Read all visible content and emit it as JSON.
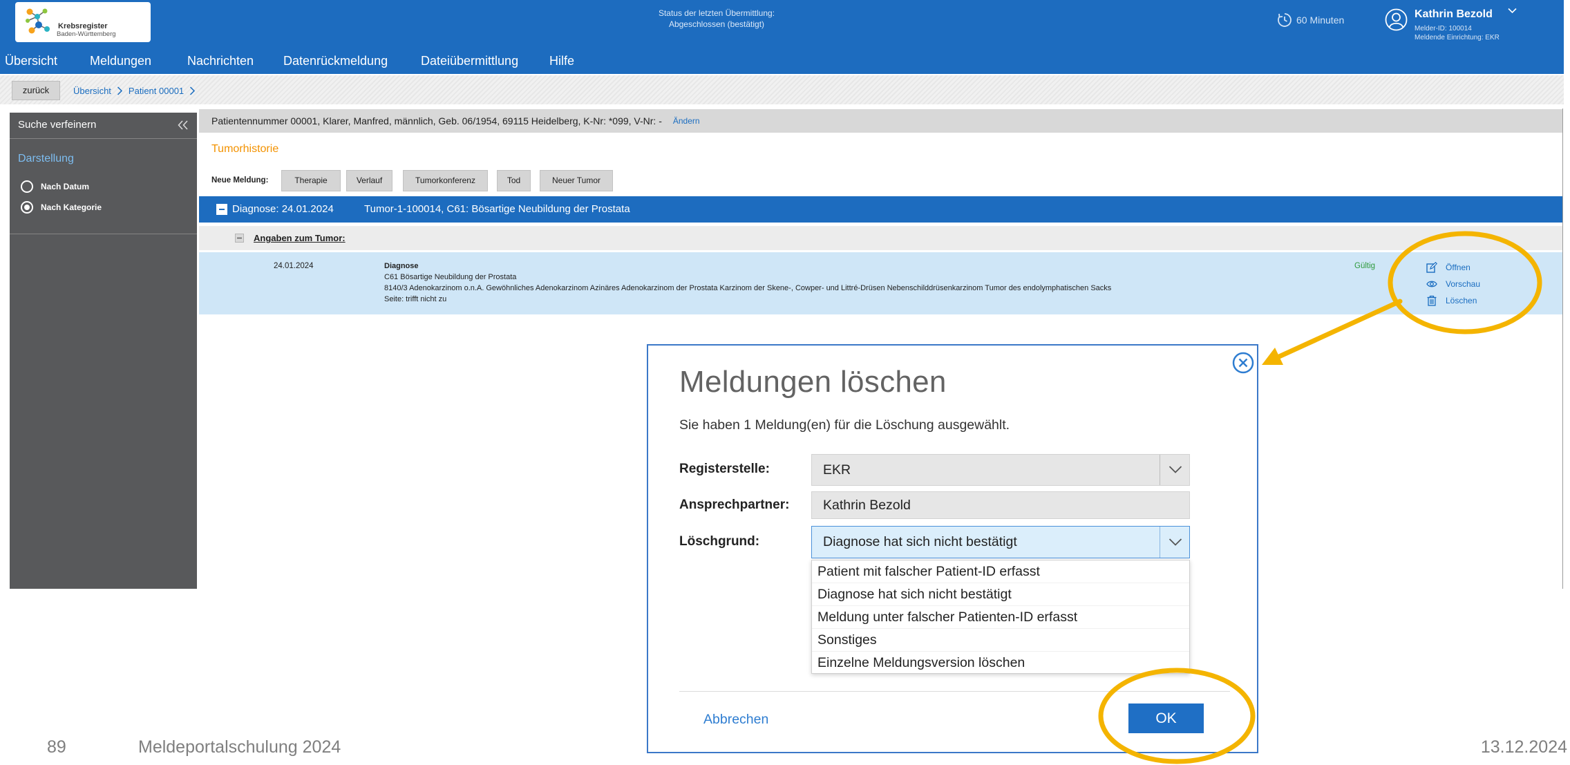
{
  "header": {
    "logo": {
      "line1": "Krebsregister",
      "line2": "Baden-Württemberg",
      "icon": "krebsregister-logo-icon"
    },
    "status": {
      "line1": "Status der letzten Übermittlung:",
      "line2": "Abgeschlossen (bestätigt)"
    },
    "session": {
      "icon": "clock-icon",
      "label": "60 Minuten"
    },
    "user": {
      "icon": "user-icon",
      "name": "Kathrin Bezold",
      "melder_id": "Melder-ID: 100014",
      "einrichtung": "Meldende Einrichtung: EKR"
    }
  },
  "nav": [
    {
      "label": "Übersicht"
    },
    {
      "label": "Meldungen"
    },
    {
      "label": "Nachrichten"
    },
    {
      "label": "Datenrückmeldung"
    },
    {
      "label": "Dateiübermittlung"
    },
    {
      "label": "Hilfe"
    }
  ],
  "breadcrumb": {
    "back": "zurück",
    "items": [
      "Übersicht",
      "Patient 00001"
    ],
    "separator_icon": "chevron-right-icon"
  },
  "sidebar": {
    "title": "Suche verfeinern",
    "collapse_icon": "double-chevron-left-icon",
    "section": "Darstellung",
    "options": [
      {
        "label": "Nach Datum",
        "selected": false
      },
      {
        "label": "Nach Kategorie",
        "selected": true
      }
    ]
  },
  "patient": {
    "info": "Patientennummer 00001, Klarer, Manfred, männlich, Geb. 06/1954, 69115 Heidelberg, K-Nr: *099, V-Nr: -",
    "edit": "Ändern"
  },
  "tumorhistorie": {
    "title": "Tumorhistorie",
    "neue_meldung_label": "Neue Meldung:",
    "buttons": [
      "Therapie",
      "Verlauf",
      "Tumorkonferenz",
      "Tod",
      "Neuer Tumor"
    ]
  },
  "diagnose_group": {
    "date": "Diagnose: 24.01.2024",
    "tumor": "Tumor-1-100014, C61: Bösartige Neubildung der Prostata",
    "icon": "minus-box-icon"
  },
  "angaben": {
    "label": "Angaben zum Tumor:",
    "icon": "minus-box-icon"
  },
  "meldung": {
    "date": "24.01.2024",
    "type": "Diagnose",
    "lines": [
      "C61 Bösartige Neubildung der Prostata",
      "8140/3 Adenokarzinom o.n.A. Gewöhnliches Adenokarzinom Azinäres Adenokarzinom der Prostata Karzinom der Skene-, Cowper- und Littré-Drüsen Nebenschilddrüsenkarzinom Tumor des endolymphatischen Sacks",
      "Seite: trifft nicht zu"
    ],
    "status": "Gültig",
    "actions": [
      {
        "label": "Öffnen",
        "icon": "edit-icon"
      },
      {
        "label": "Vorschau",
        "icon": "eye-icon"
      },
      {
        "label": "Löschen",
        "icon": "trash-icon"
      }
    ]
  },
  "dialog": {
    "title": "Meldungen löschen",
    "message": "Sie haben 1 Meldung(en) für die Löschung ausgewählt.",
    "close_icon": "close-circle-icon",
    "fields": {
      "registerstelle": {
        "label": "Registerstelle:",
        "value": "EKR"
      },
      "ansprechpartner": {
        "label": "Ansprechpartner:",
        "value": "Kathrin Bezold"
      },
      "loeschgrund": {
        "label": "Löschgrund:",
        "value": "Diagnose hat sich nicht bestätigt"
      }
    },
    "loeschgrund_options": [
      "Patient mit falscher Patient-ID erfasst",
      "Diagnose hat sich nicht bestätigt",
      "Meldung unter falscher Patienten-ID erfasst",
      "Sonstiges",
      "Einzelne Meldungsversion löschen"
    ],
    "cancel": "Abbrechen",
    "ok": "OK"
  },
  "slide": {
    "page": "89",
    "title": "Meldeportalschulung 2024",
    "date": "13.12.2024"
  },
  "colors": {
    "brand": "#1d6cbf",
    "link": "#1a6dc0",
    "highlight": "#f4b400",
    "valid": "#2e9a3c",
    "tumorhistorie": "#f39200",
    "sidebar": "#58595b",
    "selected_row": "#cfe6f7",
    "dialog_border": "#3b78c8",
    "button_primary": "#1f6fc5"
  }
}
